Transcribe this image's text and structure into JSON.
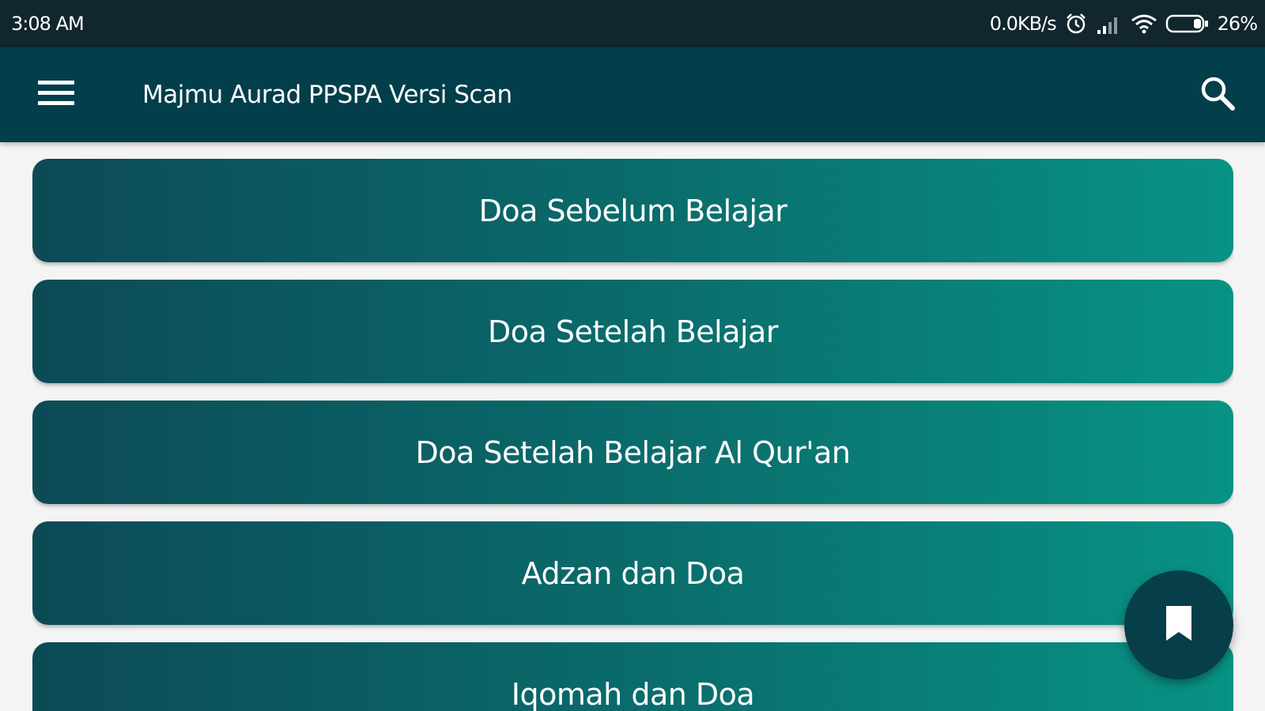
{
  "status_bar": {
    "time": "3:08 AM",
    "network_speed": "0.0KB/s",
    "battery": "26%",
    "icons": [
      "alarm-icon",
      "signal-icon",
      "wifi-icon",
      "battery-icon"
    ]
  },
  "app_bar": {
    "title": "Majmu Aurad PPSPA Versi Scan",
    "menu_icon": "hamburger-menu-icon",
    "search_icon": "search-icon"
  },
  "list": {
    "items": [
      {
        "label": "Doa Sebelum Belajar"
      },
      {
        "label": "Doa Setelah Belajar"
      },
      {
        "label": "Doa Setelah Belajar Al Qur'an"
      },
      {
        "label": "Adzan dan Doa"
      },
      {
        "label": "Iqomah dan Doa"
      }
    ]
  },
  "fab": {
    "icon": "bookmark-icon"
  },
  "colors": {
    "status_bar": "#11262d",
    "app_bar": "#033e4b",
    "item_gradient_start": "#0c4a56",
    "item_gradient_end": "#089384",
    "background": "#f4f4f4"
  }
}
